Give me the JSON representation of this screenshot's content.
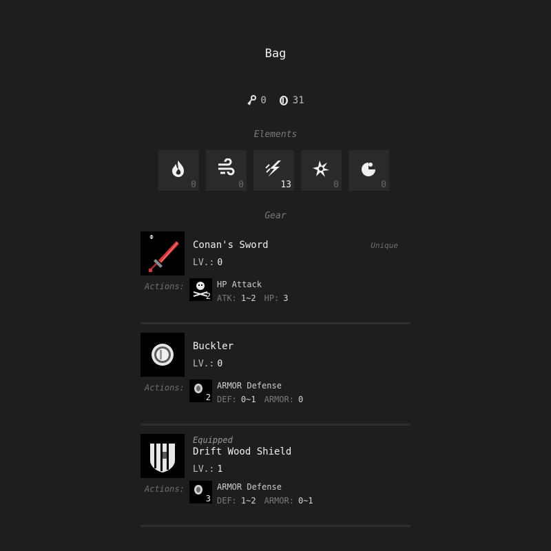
{
  "title": "Bag",
  "currency": {
    "keys": {
      "icon": "key-icon",
      "value": "0"
    },
    "coins": {
      "icon": "coin-icon",
      "value": "31"
    }
  },
  "elements_label": "Elements",
  "elements": [
    {
      "name": "fire",
      "icon": "fire-element-icon",
      "count": "0",
      "active": false
    },
    {
      "name": "wind",
      "icon": "wind-element-icon",
      "count": "0",
      "active": false
    },
    {
      "name": "lightning",
      "icon": "lightning-element-icon",
      "count": "13",
      "active": true
    },
    {
      "name": "earth",
      "icon": "earth-element-icon",
      "count": "0",
      "active": false
    },
    {
      "name": "water",
      "icon": "water-element-icon",
      "count": "0",
      "active": false
    }
  ],
  "gear_label": "Gear",
  "gear": [
    {
      "equipped": "",
      "name": "Conan's Sword",
      "rarity": "Unique",
      "level_label": "LV.:",
      "level": "0",
      "actions_label": "Actions:",
      "action": {
        "name": "HP Attack",
        "count": "2",
        "icon": "skull-attack-icon",
        "stats": [
          {
            "label": "ATK:",
            "value": "1~2"
          },
          {
            "label": "HP:",
            "value": "3"
          }
        ]
      }
    },
    {
      "equipped": "",
      "name": "Buckler",
      "rarity": "",
      "level_label": "LV.:",
      "level": "0",
      "actions_label": "Actions:",
      "action": {
        "name": "ARMOR Defense",
        "count": "2",
        "icon": "armor-defense-icon",
        "stats": [
          {
            "label": "DEF:",
            "value": "0~1"
          },
          {
            "label": "ARMOR:",
            "value": "0"
          }
        ]
      }
    },
    {
      "equipped": "Equipped",
      "name": "Drift Wood Shield",
      "rarity": "",
      "level_label": "LV.:",
      "level": "1",
      "actions_label": "Actions:",
      "action": {
        "name": "ARMOR Defense",
        "count": "3",
        "icon": "armor-defense-icon",
        "stats": [
          {
            "label": "DEF:",
            "value": "1~2"
          },
          {
            "label": "ARMOR:",
            "value": "0~1"
          }
        ]
      }
    }
  ],
  "colors": {
    "background": "#1e1e1e",
    "tile": "#2a2a2a",
    "sword_red": "#d23a3a"
  }
}
